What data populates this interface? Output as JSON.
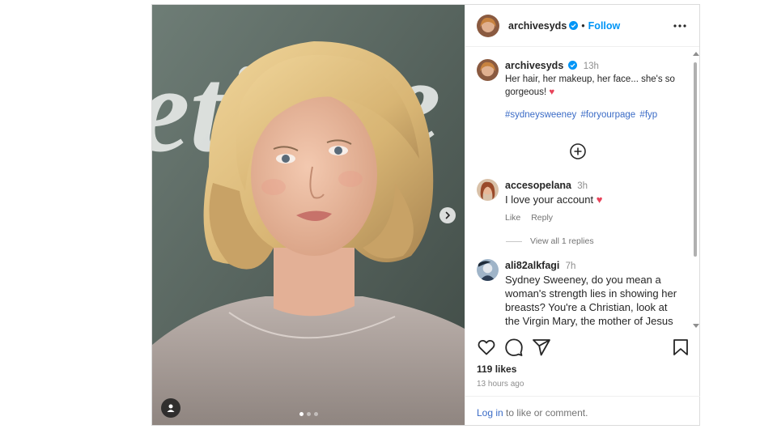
{
  "post": {
    "author": "archivesyds",
    "follow_label": "Follow",
    "bullet": "•",
    "caption": {
      "author": "archivesyds",
      "time": "13h",
      "text": "Her hair, her makeup, her face... she's so gorgeous!",
      "emoji": "♥",
      "hashtags": [
        "#sydneysweeney",
        "#foryourpage",
        "#fyp"
      ]
    },
    "comments": [
      {
        "author": "accesopelana",
        "time": "3h",
        "text": "I love your account",
        "emoji": "♥",
        "like_label": "Like",
        "reply_label": "Reply",
        "view_replies": "View all 1 replies"
      },
      {
        "author": "ali82alkfagi",
        "time": "7h",
        "text": "Sydney Sweeney, do you mean a woman's strength lies in showing her breasts? You're a Christian, look at the Virgin Mary, the mother of Jesus Christ, the Prophet"
      }
    ],
    "likes": "119 likes",
    "posted_ago": "13 hours ago",
    "login_link": "Log in",
    "login_suffix": " to like or comment.",
    "carousel_count": 3,
    "carousel_active": 1
  },
  "colors": {
    "accent": "#0095f6",
    "hashtag": "#3a6bc6",
    "heart": "#e8435a",
    "muted": "#8e8e8e"
  },
  "icons": {
    "like": "heart-icon",
    "comment": "comment-icon",
    "share": "share-icon",
    "save": "bookmark-icon",
    "more": "more-options-icon",
    "add": "add-circle-icon",
    "next": "chevron-right-icon",
    "tag": "user-tag-icon",
    "verified": "verified-badge-icon"
  }
}
